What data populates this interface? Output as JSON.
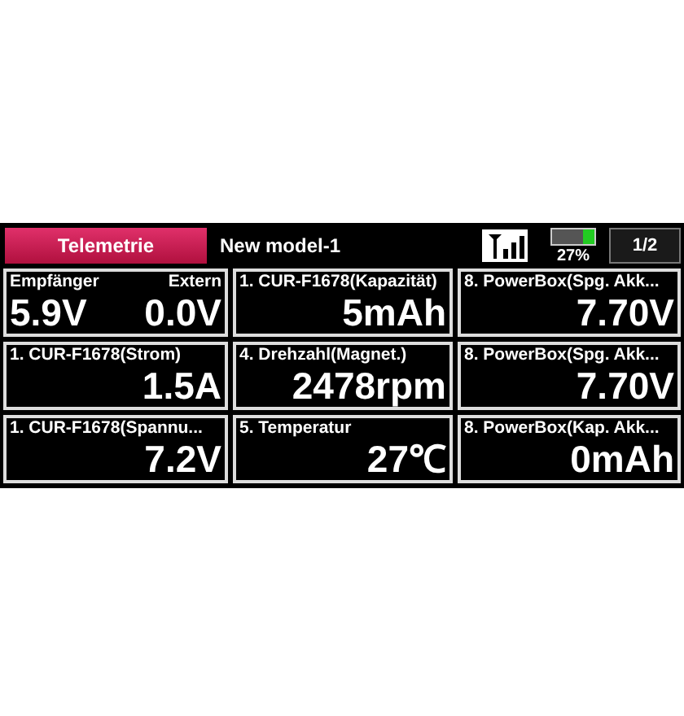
{
  "header": {
    "tab": {
      "label": "Telemetrie",
      "selected": true
    },
    "model": "New model-1",
    "battery": {
      "level": 0.27,
      "reading": "27%"
    },
    "page": "1/2"
  },
  "cells": [
    {
      "kind": "dual",
      "items": [
        {
          "label": "Empfänger",
          "value": "5.9V"
        },
        {
          "label": "Extern",
          "value": "0.0V"
        }
      ]
    },
    {
      "kind": "single",
      "label": "1. CUR-F1678(Kapazität)",
      "value": "5mAh"
    },
    {
      "kind": "single",
      "label": "8. PowerBox(Spg. Akk...",
      "value": "7.70V"
    },
    {
      "kind": "single",
      "label": "1. CUR-F1678(Strom)",
      "value": "1.5A"
    },
    {
      "kind": "single",
      "label": "4. Drehzahl(Magnet.)",
      "value": "2478rpm"
    },
    {
      "kind": "single",
      "label": "8. PowerBox(Spg. Akk...",
      "value": "7.70V"
    },
    {
      "kind": "single",
      "label": "1. CUR-F1678(Spannu...",
      "value": "7.2V"
    },
    {
      "kind": "single",
      "label": "5. Temperatur",
      "value": "27℃"
    },
    {
      "kind": "single",
      "label": "8. PowerBox(Kap. Akk...",
      "value": "0mAh"
    }
  ]
}
